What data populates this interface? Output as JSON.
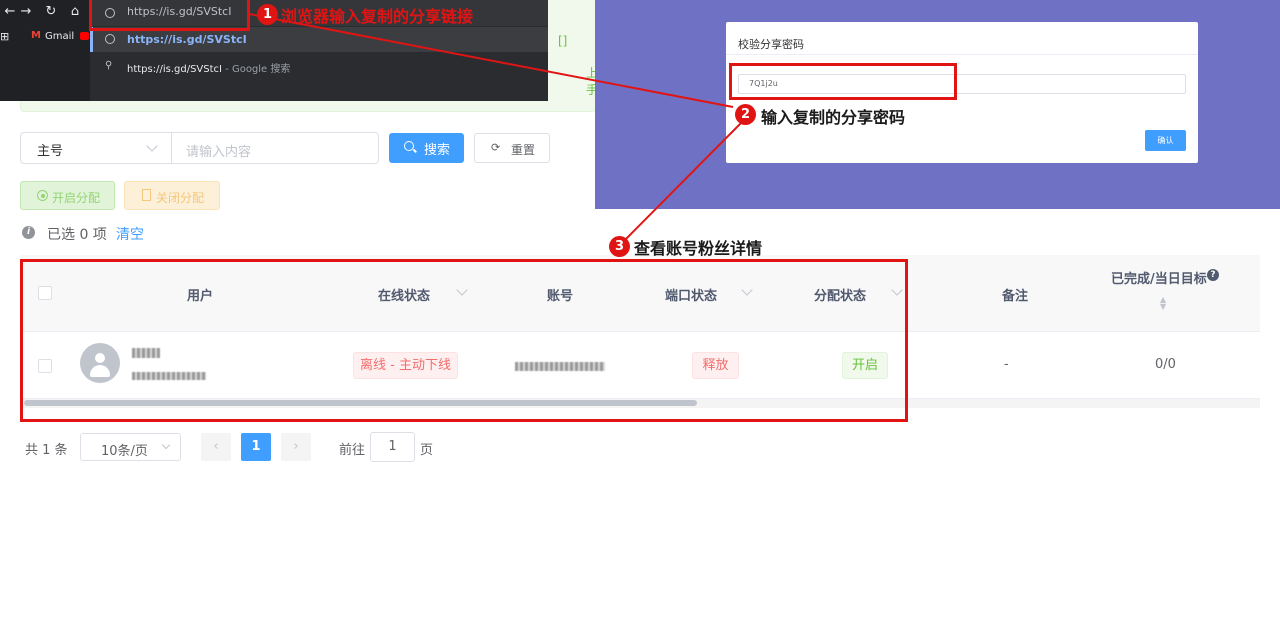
{
  "browser": {
    "nav_back": "←",
    "nav_forward": "→",
    "nav_reload": "↻",
    "nav_home": "⌂",
    "address_text": "https://is.gd/SVStcI",
    "bookmarks": {
      "apps_icon": "apps-grid-icon",
      "gmail_label": "Gmail"
    },
    "suggestions": [
      {
        "icon": "globe-icon",
        "text": "https://is.gd/SVStcI",
        "sub": ""
      },
      {
        "icon": "search-icon",
        "text": "https://is.gd/SVStcI",
        "sub": " - Google 搜索"
      }
    ]
  },
  "notice": {
    "text_fragment_1": "[]",
    "text_fragment_2": "上手"
  },
  "dialog": {
    "title": "校验分享密码",
    "password_value": "7Q1j2u",
    "confirm_label": "确认"
  },
  "search": {
    "field_select_value": "主号",
    "keyword_placeholder": "请输入内容",
    "search_label": "搜索",
    "reset_label": "重置"
  },
  "actions": {
    "start_label": "开启分配",
    "close_label": "关闭分配"
  },
  "selection": {
    "info_text": "已选 0 项",
    "clear_label": "清空"
  },
  "table": {
    "columns": {
      "user": "用户",
      "online_status": "在线状态",
      "account": "账号",
      "port_status": "端口状态",
      "assign_status": "分配状态",
      "remark": "备注",
      "progress": "已完成/当日目标"
    },
    "rows": [
      {
        "online_status": "离线 - 主动下线",
        "port_status": "释放",
        "assign_status": "开启",
        "remark": "-",
        "progress": "0/0"
      }
    ]
  },
  "pagination": {
    "total": "共 1 条",
    "page_size": "10条/页",
    "prev": "‹",
    "current_page": "1",
    "next": "›",
    "goto_label": "前往",
    "goto_value": "1",
    "page_suffix": "页"
  },
  "annotations": {
    "step1_number": "1",
    "step1_text": "浏览器输入复制的分享链接",
    "step2_number": "2",
    "step2_text": "输入复制的分享密码",
    "step3_number": "3",
    "step3_text": "查看账号粉丝详情"
  },
  "colors": {
    "primary": "#409eff",
    "annotation_red": "#e11414",
    "purple_bg": "#6f72c4",
    "success": "#67c23a",
    "danger": "#f56c6c"
  }
}
